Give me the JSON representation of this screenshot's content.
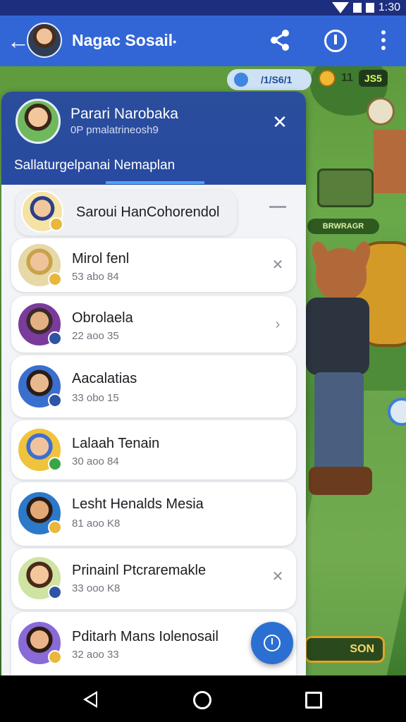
{
  "status_bar": {
    "time": "1:30"
  },
  "app_bar": {
    "back_icon": "arrow-left-icon",
    "title": "Nagac Sosail",
    "title_suffix": "•",
    "actions": [
      "share-icon",
      "info-icon",
      "more-vert-icon"
    ]
  },
  "game_hud": {
    "pill_label": "/1/S6/1",
    "score_prefix": "11",
    "score_value": "JS5",
    "sign_label": "BRWRAGR",
    "play_button": "SON"
  },
  "panel": {
    "name": "Parari Narobaka",
    "subtitle": "0P pmalatrineosh9",
    "close_icon": "close-icon",
    "tab_label": "Sallaturgelpanai Nemaplan"
  },
  "list": [
    {
      "name": "Saroui HanCohorendol",
      "time": "",
      "badge_color": "#e9b73a",
      "avatar_color": "#f5e3a5"
    },
    {
      "name": "Mirol fenl",
      "time": "53 abo 84",
      "badge_color": "#e9b73a",
      "avatar_color": "#e7d8a8"
    },
    {
      "name": "Obrolaela",
      "time": "22 aoo 35",
      "badge_color": "#2d55a3",
      "avatar_color": "#7a3b9c"
    },
    {
      "name": "Aacalatias",
      "time": "33 obo 15",
      "badge_color": "#2d55a3",
      "avatar_color": "#3a6fcf"
    },
    {
      "name": "Lalaah Tenain",
      "time": "30 aoo 84",
      "badge_color": "#3aa449",
      "avatar_color": "#f0c33d"
    },
    {
      "name": "Lesht Henalds Mesia",
      "time": "81 aoo K8",
      "badge_color": "#e9b73a",
      "avatar_color": "#2c79c9"
    },
    {
      "name": "Prinainl Ptcraremakle",
      "time": "33 ooo K8",
      "badge_color": "#2d55a3",
      "avatar_color": "#cfe3a2"
    },
    {
      "name": "Pditarh Mans Iolenosail",
      "time": "32 aoo 33",
      "badge_color": "#e9b73a",
      "avatar_color": "#8a6ad6"
    }
  ],
  "fab_icon": "clock-icon",
  "nav_bar": [
    "nav-back-icon",
    "nav-home-icon",
    "nav-recent-icon"
  ]
}
